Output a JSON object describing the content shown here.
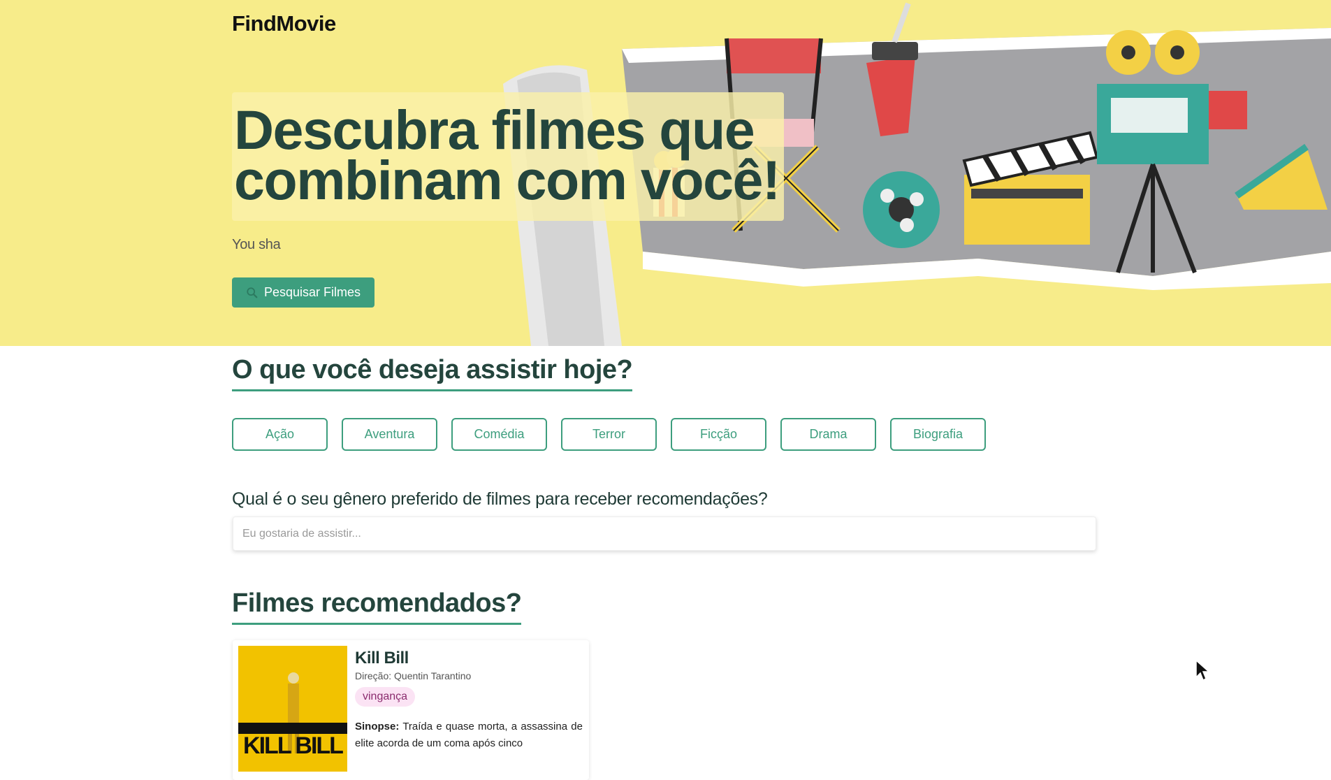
{
  "brand": {
    "logo": "FindMovie"
  },
  "hero": {
    "headline": "Descubra filmes que combinam com você!",
    "subtitle": "You sha",
    "search_button": "Pesquisar Filmes",
    "search_icon": "search-icon"
  },
  "genres_section": {
    "title": "O que você deseja assistir hoje?",
    "genres": [
      "Ação",
      "Aventura",
      "Comédia",
      "Terror",
      "Ficção",
      "Drama",
      "Biografia"
    ]
  },
  "preference": {
    "question": "Qual é o seu gênero preferido de filmes para receber recomendações?",
    "placeholder": "Eu gostaria de assistir..."
  },
  "recommended": {
    "title": "Filmes recomendados?",
    "movies": [
      {
        "title": "Kill Bill",
        "director": "Direção: Quentin Tarantino",
        "tag": "vingança",
        "synopsis_label": "Sinopse:",
        "synopsis": "Traída e quase morta, a assassina de elite acorda de um coma após cinco",
        "poster_text": "KILL BILL"
      }
    ]
  },
  "colors": {
    "hero_bg": "#f7ec8a",
    "accent": "#3d9e7e",
    "heading": "#24453d",
    "tag_bg": "#fbe3f4"
  }
}
